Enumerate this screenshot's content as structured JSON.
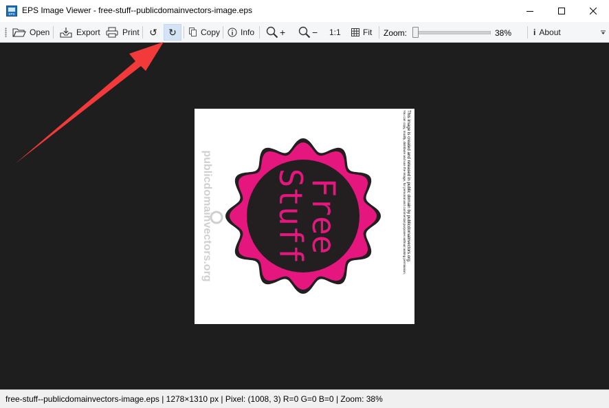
{
  "window": {
    "title": "EPS Image Viewer - free-stuff--publicdomainvectors-image.eps",
    "app_icon_label": "EPS",
    "controls": [
      "minimize",
      "maximize",
      "close"
    ]
  },
  "toolbar": {
    "open_label": "Open",
    "export_label": "Export",
    "print_label": "Print",
    "rotate_left_label": "↺",
    "rotate_right_label": "↻",
    "copy_label": "Copy",
    "info_label": "Info",
    "zoom_in_label": "+",
    "zoom_out_label": "−",
    "actual_size_label": "1:1",
    "fit_label": "Fit",
    "zoom_label": "Zoom:",
    "zoom_value": "38%",
    "zoom_percent": 38,
    "about_label": "About"
  },
  "image": {
    "badge_line1": "Free",
    "badge_line2": "Stuff",
    "watermark": "publicdomainvectors.org",
    "side_text_1": "This image is created and released in public domain by publicdomainvectors.org.",
    "side_text_2": "You can copy, modify, distribute and use the image, for personal and commercial purposes without asking permission.",
    "colors": {
      "badge_outer": "#e5177e",
      "badge_outline": "#231f20",
      "badge_inner": "#231f20",
      "badge_text": "#e5177e"
    }
  },
  "statusbar": {
    "text": "free-stuff--publicdomainvectors-image.eps | 1278×1310 px | Pixel: (1008, 3) R=0 G=0 B=0 | Zoom: 38%"
  },
  "annotation": {
    "arrow_color": "#f23a3a"
  }
}
